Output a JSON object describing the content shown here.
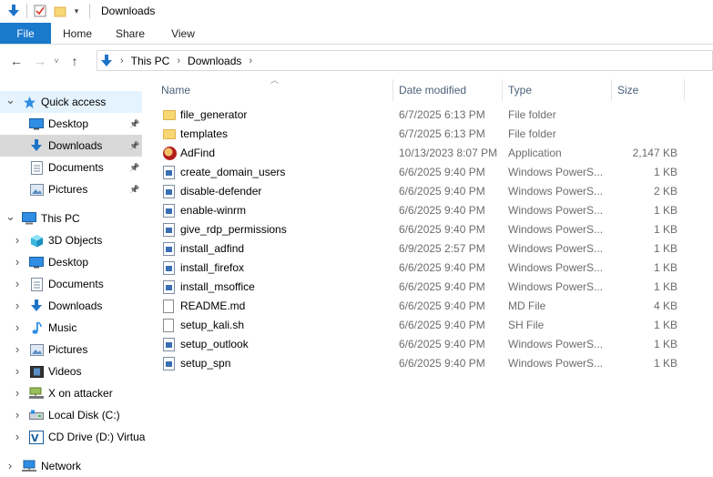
{
  "window": {
    "title": "Downloads"
  },
  "ribbon": {
    "tabs": [
      "File",
      "Home",
      "Share",
      "View"
    ]
  },
  "address": {
    "crumbs": [
      "This PC",
      "Downloads"
    ]
  },
  "sidebar": {
    "items": [
      {
        "label": "Quick access",
        "icon": "star-icon",
        "expander": "expanded",
        "level": 0
      },
      {
        "label": "Desktop",
        "icon": "desktop-icon",
        "pinned": true,
        "level": 1
      },
      {
        "label": "Downloads",
        "icon": "download-arrow-icon",
        "pinned": true,
        "level": 1,
        "selected": true
      },
      {
        "label": "Documents",
        "icon": "documents-icon",
        "pinned": true,
        "level": 1
      },
      {
        "label": "Pictures",
        "icon": "pictures-icon",
        "pinned": true,
        "level": 1
      },
      {
        "label": "This PC",
        "icon": "computer-icon",
        "expander": "expanded",
        "level": 0
      },
      {
        "label": "3D Objects",
        "icon": "cube-icon",
        "expander": "collapsed",
        "level": 1
      },
      {
        "label": "Desktop",
        "icon": "desktop-icon",
        "expander": "collapsed",
        "level": 1
      },
      {
        "label": "Documents",
        "icon": "documents-icon",
        "expander": "collapsed",
        "level": 1
      },
      {
        "label": "Downloads",
        "icon": "download-arrow-icon",
        "expander": "collapsed",
        "level": 1
      },
      {
        "label": "Music",
        "icon": "music-icon",
        "expander": "collapsed",
        "level": 1
      },
      {
        "label": "Pictures",
        "icon": "pictures-icon",
        "expander": "collapsed",
        "level": 1
      },
      {
        "label": "Videos",
        "icon": "videos-icon",
        "expander": "collapsed",
        "level": 1
      },
      {
        "label": "X on attacker",
        "icon": "network-drive-icon",
        "expander": "collapsed",
        "level": 1
      },
      {
        "label": "Local Disk (C:)",
        "icon": "disk-icon",
        "expander": "collapsed",
        "level": 1
      },
      {
        "label": "CD Drive (D:) Virtua",
        "icon": "cd-drive-icon",
        "expander": "collapsed",
        "level": 1
      },
      {
        "label": "Network",
        "icon": "network-icon",
        "expander": "collapsed",
        "level": 0
      }
    ]
  },
  "columns": {
    "name": "Name",
    "date": "Date modified",
    "type": "Type",
    "size": "Size"
  },
  "files": [
    {
      "name": "file_generator",
      "date": "6/7/2025 6:13 PM",
      "type": "File folder",
      "size": "",
      "icon": "folder-icon"
    },
    {
      "name": "templates",
      "date": "6/7/2025 6:13 PM",
      "type": "File folder",
      "size": "",
      "icon": "folder-icon"
    },
    {
      "name": "AdFind",
      "date": "10/13/2023 8:07 PM",
      "type": "Application",
      "size": "2,147 KB",
      "icon": "application-icon"
    },
    {
      "name": "create_domain_users",
      "date": "6/6/2025 9:40 PM",
      "type": "Windows PowerS...",
      "size": "1 KB",
      "icon": "powershell-script-icon"
    },
    {
      "name": "disable-defender",
      "date": "6/6/2025 9:40 PM",
      "type": "Windows PowerS...",
      "size": "2 KB",
      "icon": "powershell-script-icon"
    },
    {
      "name": "enable-winrm",
      "date": "6/6/2025 9:40 PM",
      "type": "Windows PowerS...",
      "size": "1 KB",
      "icon": "powershell-script-icon"
    },
    {
      "name": "give_rdp_permissions",
      "date": "6/6/2025 9:40 PM",
      "type": "Windows PowerS...",
      "size": "1 KB",
      "icon": "powershell-script-icon"
    },
    {
      "name": "install_adfind",
      "date": "6/9/2025 2:57 PM",
      "type": "Windows PowerS...",
      "size": "1 KB",
      "icon": "powershell-script-icon"
    },
    {
      "name": "install_firefox",
      "date": "6/6/2025 9:40 PM",
      "type": "Windows PowerS...",
      "size": "1 KB",
      "icon": "powershell-script-icon"
    },
    {
      "name": "install_msoffice",
      "date": "6/6/2025 9:40 PM",
      "type": "Windows PowerS...",
      "size": "1 KB",
      "icon": "powershell-script-icon"
    },
    {
      "name": "README.md",
      "date": "6/6/2025 9:40 PM",
      "type": "MD File",
      "size": "4 KB",
      "icon": "document-icon"
    },
    {
      "name": "setup_kali.sh",
      "date": "6/6/2025 9:40 PM",
      "type": "SH File",
      "size": "1 KB",
      "icon": "document-icon"
    },
    {
      "name": "setup_outlook",
      "date": "6/6/2025 9:40 PM",
      "type": "Windows PowerS...",
      "size": "1 KB",
      "icon": "powershell-script-icon"
    },
    {
      "name": "setup_spn",
      "date": "6/6/2025 9:40 PM",
      "type": "Windows PowerS...",
      "size": "1 KB",
      "icon": "powershell-script-icon"
    }
  ],
  "colors": {
    "accent": "#1979ca",
    "selected": "#d9d9d9",
    "hover": "#e5f3ff",
    "header_text": "#4c607a"
  }
}
